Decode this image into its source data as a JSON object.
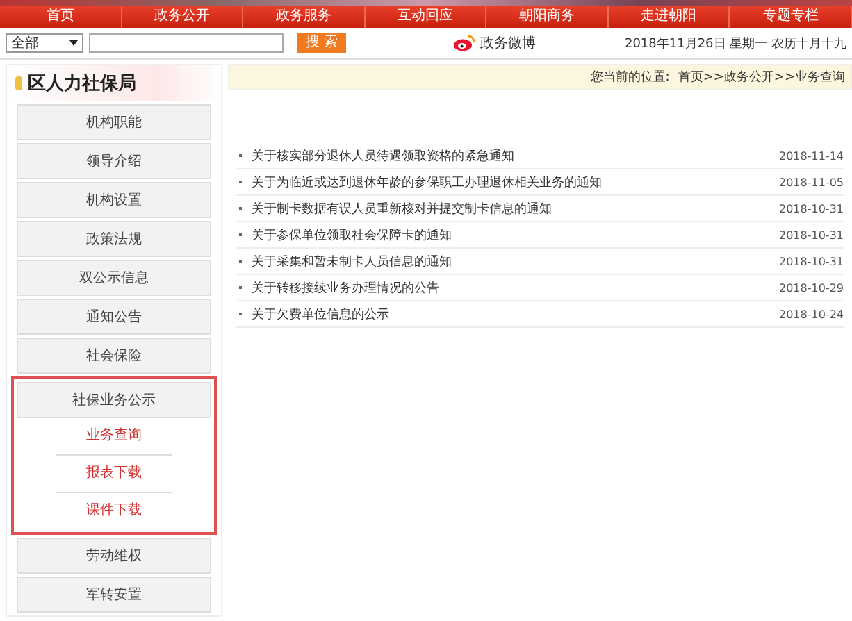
{
  "nav": [
    "首页",
    "政务公开",
    "政务服务",
    "互动回应",
    "朝阳商务",
    "走进朝阳",
    "专题专栏"
  ],
  "search": {
    "scope": "全部",
    "button": "搜 索"
  },
  "weibo": "政务微博",
  "date": "2018年11月26日 星期一 农历十月十九",
  "sidebar": {
    "title": "区人力社保局",
    "items": [
      {
        "label": "机构职能",
        "expanded": false
      },
      {
        "label": "领导介绍",
        "expanded": false
      },
      {
        "label": "机构设置",
        "expanded": false
      },
      {
        "label": "政策法规",
        "expanded": false
      },
      {
        "label": "双公示信息",
        "expanded": false
      },
      {
        "label": "通知公告",
        "expanded": false
      },
      {
        "label": "社会保险",
        "expanded": false
      },
      {
        "label": "社保业务公示",
        "expanded": true,
        "children": [
          "业务查询",
          "报表下载",
          "课件下载"
        ]
      },
      {
        "label": "劳动维权",
        "expanded": false
      },
      {
        "label": "军转安置",
        "expanded": false
      }
    ]
  },
  "breadcrumb": {
    "label": "您当前的位置:",
    "path": "首页>>政务公开>>业务查询"
  },
  "news": [
    {
      "title": "关于核实部分退休人员待遇领取资格的紧急通知",
      "date": "2018-11-14"
    },
    {
      "title": "关于为临近或达到退休年龄的参保职工办理退休相关业务的通知",
      "date": "2018-11-05"
    },
    {
      "title": "关于制卡数据有误人员重新核对并提交制卡信息的通知",
      "date": "2018-10-31"
    },
    {
      "title": "关于参保单位领取社会保障卡的通知",
      "date": "2018-10-31"
    },
    {
      "title": "关于采集和暂未制卡人员信息的通知",
      "date": "2018-10-31"
    },
    {
      "title": "关于转移接续业务办理情况的公告",
      "date": "2018-10-29"
    },
    {
      "title": "关于欠费单位信息的公示",
      "date": "2018-10-24"
    }
  ]
}
